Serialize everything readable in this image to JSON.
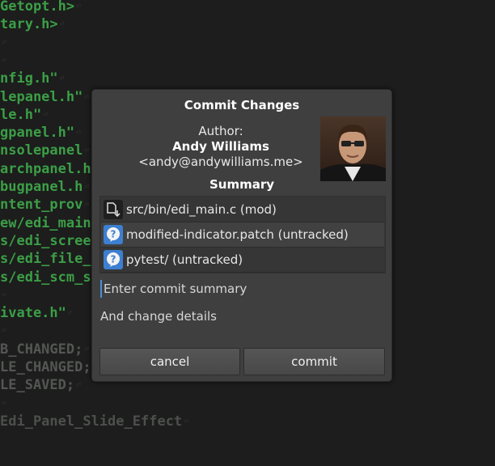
{
  "editor": {
    "lines": [
      {
        "text": "Getopt.h>",
        "color": "green"
      },
      {
        "text": "tary.h>",
        "color": "green"
      },
      {
        "text": "",
        "color": "green"
      },
      {
        "text": "",
        "color": "green"
      },
      {
        "text": "nfig.h\"",
        "color": "green"
      },
      {
        "text": "lepanel.h\"",
        "color": "green"
      },
      {
        "text": "le.h\"",
        "color": "green"
      },
      {
        "text": "gpanel.h\"",
        "color": "green"
      },
      {
        "text": "nsolepanel",
        "color": "green"
      },
      {
        "text": "archpanel.h",
        "color": "green"
      },
      {
        "text": "bugpanel.h",
        "color": "green"
      },
      {
        "text": "ntent_prov",
        "color": "green"
      },
      {
        "text": "ew/edi_main",
        "color": "green"
      },
      {
        "text": "s/edi_scree",
        "color": "green"
      },
      {
        "text": "s/edi_file_",
        "color": "green"
      },
      {
        "text": "s/edi_scm_s",
        "color": "green"
      },
      {
        "text": "",
        "color": "green"
      },
      {
        "text": "ivate.h\"",
        "color": "green"
      },
      {
        "text": "",
        "color": "green"
      },
      {
        "text": "B_CHANGED;",
        "color": "grey"
      },
      {
        "text": "LE_CHANGED;",
        "color": "grey"
      },
      {
        "text": "LE_SAVED;",
        "color": "grey"
      },
      {
        "text": "",
        "color": "grey"
      },
      {
        "text": "Edi_Panel_Slide_Effect",
        "color": "dark"
      }
    ],
    "eol_marker": "⏎"
  },
  "dialog": {
    "title": "Commit Changes",
    "author_label": "Author:",
    "author_name": "Andy Williams",
    "author_email": "<andy@andywilliams.me>",
    "summary_heading": "Summary",
    "files": [
      {
        "path": "src/bin/edi_main.c (mod)",
        "icon": "modified-file-icon"
      },
      {
        "path": "modified-indicator.patch (untracked)",
        "icon": "untracked-help-icon"
      },
      {
        "path": "pytest/ (untracked)",
        "icon": "untracked-help-icon"
      }
    ],
    "summary_placeholder": "Enter commit summary",
    "details_placeholder": "And change details",
    "cancel_label": "cancel",
    "commit_label": "commit"
  },
  "colors": {
    "editor_bg": "#1c1d1c",
    "code_green": "#3c9e47",
    "dialog_bg": "#3e3f3e",
    "untracked_icon": "#3d7fd1"
  }
}
